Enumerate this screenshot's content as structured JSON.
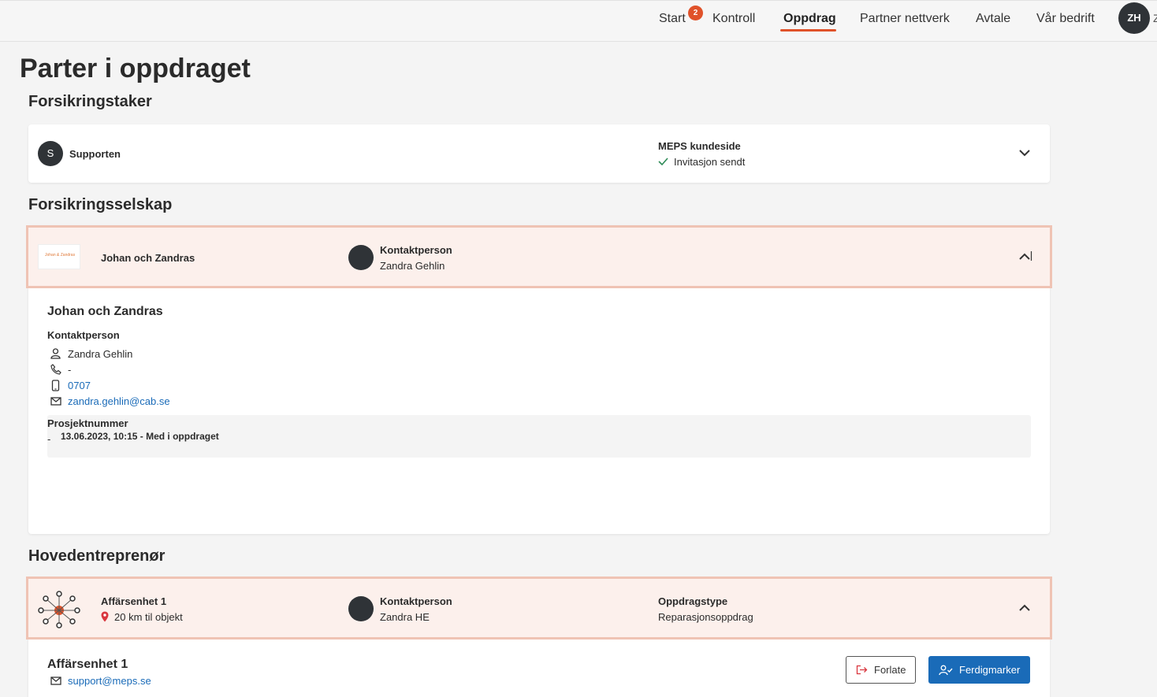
{
  "nav": {
    "items": [
      "Start",
      "Kontroll",
      "Oppdrag",
      "Partner nettverk",
      "Avtale",
      "Vår bedrift"
    ],
    "badge": "2",
    "user_initials": "ZH",
    "cut_label": "Z"
  },
  "page_title": "Parter i oppdraget",
  "policyholder": {
    "section": "Forsikringstaker",
    "avatar": "S",
    "name": "Supporten",
    "portal_label": "MEPS kundeside",
    "portal_status": "Invitasjon sendt"
  },
  "insurer": {
    "section": "Forsikringsselskap",
    "logo_text": "Johan & Zandras",
    "name": "Johan och Zandras",
    "contact_label": "Kontaktperson",
    "contact_name": "Zandra Gehlin",
    "details": {
      "title": "Johan och Zandras",
      "contact_heading": "Kontaktperson",
      "person": "Zandra Gehlin",
      "phone": "-",
      "mobile": "0707",
      "email": "zandra.gehlin@cab.se",
      "project_heading": "Prosjektnummer",
      "project_value": "-",
      "history": "13.06.2023, 10:15 - Med i oppdraget"
    }
  },
  "contractor": {
    "section": "Hovedentreprenør",
    "name": "Affärsenhet 1",
    "distance": "20 km til objekt",
    "contact_label": "Kontaktperson",
    "contact_name": "Zandra HE",
    "type_label": "Oppdragstype",
    "type_value": "Reparasjonsoppdrag",
    "details_title": "Affärsenhet 1",
    "details_email": "support@meps.se",
    "leave_label": "Forlate",
    "complete_label": "Ferdigmarker"
  },
  "colors": {
    "accent": "#e0522a",
    "primary": "#1a6bb8",
    "highlight_bg": "#fcf0ec",
    "highlight_border": "#efc3b4",
    "success": "#2e8b57",
    "pin": "#d9363e"
  }
}
